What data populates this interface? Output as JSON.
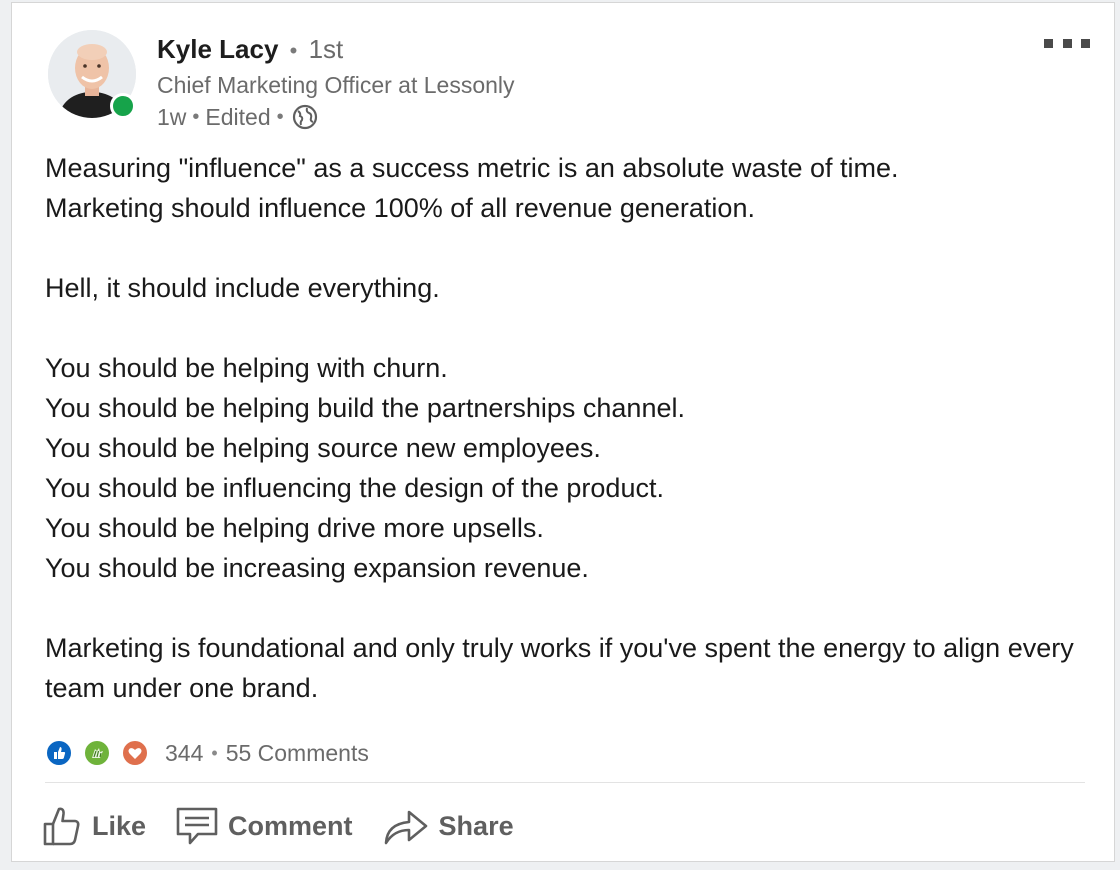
{
  "post": {
    "author": {
      "name": "Kyle Lacy",
      "connection_degree": "1st",
      "headline": "Chief Marketing Officer at Lessonly",
      "online_status_color": "#16a34a"
    },
    "meta": {
      "age": "1w",
      "edited": "Edited",
      "visibility_icon": "globe-icon"
    },
    "more_menu_icon": "more-dots-icon",
    "body": {
      "line1": "Measuring \"influence\" as a success metric is an absolute waste of time.",
      "line2": "Marketing should influence 100% of all revenue generation.",
      "line3": "Hell, it should include everything.",
      "list": [
        "You should be helping with churn.",
        "You should be helping build the partnerships channel.",
        "You should be helping source new employees.",
        "You should be influencing the design of the product.",
        "You should be helping drive more upsells.",
        "You should be increasing expansion revenue."
      ],
      "closing": "Marketing is foundational and only truly works if you've spent the energy to align every team under one brand."
    },
    "social": {
      "reaction_icons": [
        "like-icon",
        "celebrate-icon",
        "love-icon"
      ],
      "reaction_count": "344",
      "comments": "55 Comments"
    },
    "actions": {
      "like": "Like",
      "comment": "Comment",
      "share": "Share"
    },
    "colors": {
      "like_blue": "#0a66c2",
      "celebrate_green": "#6fb33b",
      "love_orange": "#df704d"
    }
  }
}
